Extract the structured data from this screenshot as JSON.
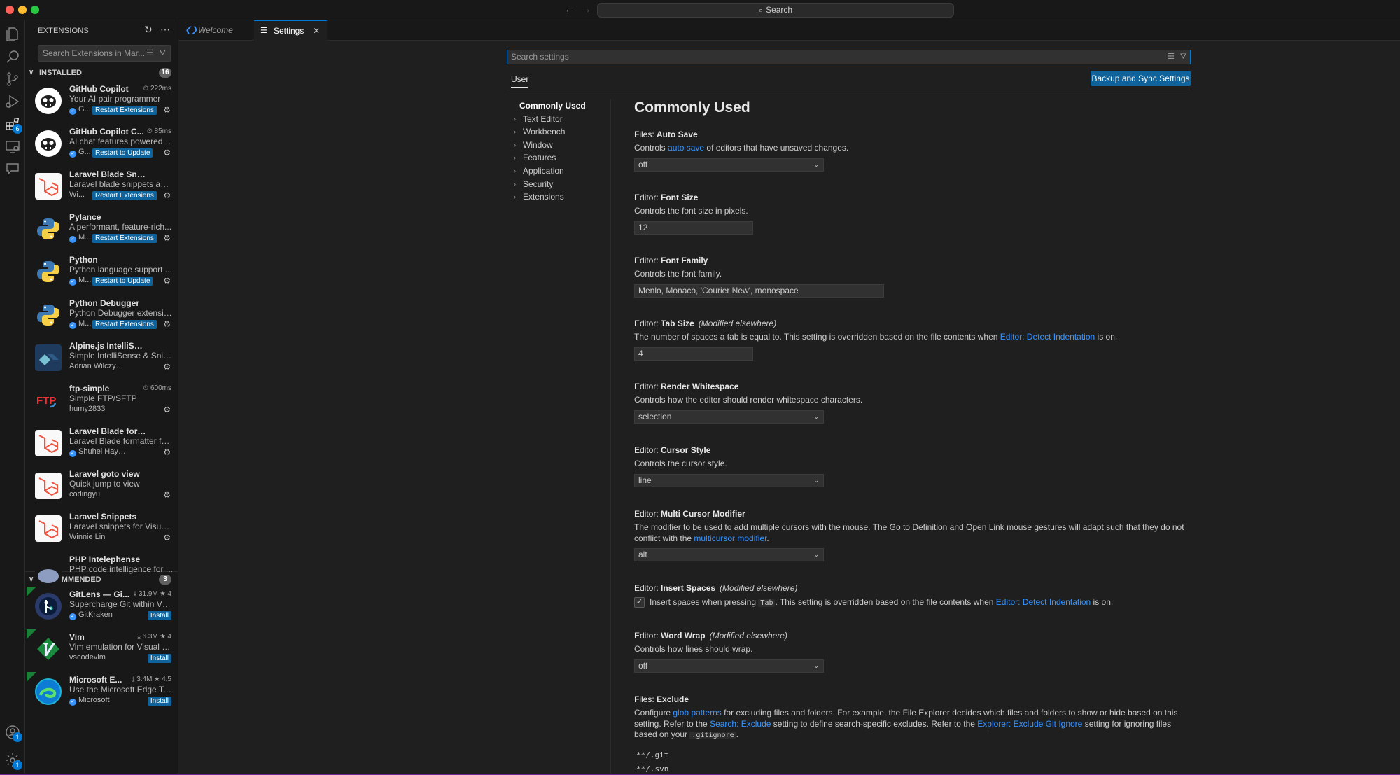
{
  "titlebar": {
    "search_label": "Search"
  },
  "sidebar": {
    "title": "EXTENSIONS",
    "search_placeholder": "Search Extensions in Mar...",
    "installed": {
      "label": "INSTALLED",
      "count": "16",
      "items": [
        {
          "name": "GitHub Copilot",
          "meta": "⏲ 222ms",
          "desc": "Your AI pair programmer",
          "pub": "G...",
          "action": "Restart Extensions",
          "icon": "copilot-icon"
        },
        {
          "name": "GitHub Copilot C...",
          "meta": "⏲ 85ms",
          "desc": "AI chat features powered b...",
          "pub": "G...",
          "action": "Restart to Update",
          "icon": "copilot-icon"
        },
        {
          "name": "Laravel Blade Snippets",
          "meta": "",
          "desc": "Laravel blade snippets and...",
          "pub": "Wi...",
          "action": "Restart Extensions",
          "icon": "laravel-icon"
        },
        {
          "name": "Pylance",
          "meta": "",
          "desc": "A performant, feature-rich...",
          "pub": "M...",
          "action": "Restart Extensions",
          "icon": "python-icon"
        },
        {
          "name": "Python",
          "meta": "",
          "desc": "Python language support ...",
          "pub": "M...",
          "action": "Restart to Update",
          "icon": "python-icon"
        },
        {
          "name": "Python Debugger",
          "meta": "",
          "desc": "Python Debugger extensio...",
          "pub": "M...",
          "action": "Restart Extensions",
          "icon": "python-icon"
        },
        {
          "name": "Alpine.js IntelliSense",
          "meta": "",
          "desc": "Simple IntelliSense & Snip...",
          "pub": "Adrian Wilczyński",
          "action": "",
          "icon": "alpine-icon"
        },
        {
          "name": "ftp-simple",
          "meta": "⏲ 600ms",
          "desc": "Simple FTP/SFTP",
          "pub": "humy2833",
          "action": "",
          "icon": "ftp-icon"
        },
        {
          "name": "Laravel Blade formatter",
          "meta": "",
          "desc": "Laravel Blade formatter for...",
          "pub": "Shuhei Hayashibara",
          "action": "",
          "icon": "laravel-icon"
        },
        {
          "name": "Laravel goto view",
          "meta": "",
          "desc": "Quick jump to view",
          "pub": "codingyu",
          "action": "",
          "icon": "laravel-icon"
        },
        {
          "name": "Laravel Snippets",
          "meta": "",
          "desc": "Laravel snippets for Visual ...",
          "pub": "Winnie Lin",
          "action": "",
          "icon": "laravel-icon"
        },
        {
          "name": "PHP Intelephense",
          "meta": "",
          "desc": "PHP code intelligence for ...",
          "pub": "",
          "action": "",
          "icon": "php-icon"
        }
      ]
    },
    "recommended": {
      "label": "RECOMMENDED",
      "count": "3",
      "items": [
        {
          "name": "GitLens — Gi...",
          "meta": "⤓ 31.9M ★ 4",
          "desc": "Supercharge Git within VS ...",
          "pub": "GitKraken",
          "action": "Install",
          "icon": "gitlens-icon"
        },
        {
          "name": "Vim",
          "meta": "⤓ 6.3M ★ 4",
          "desc": "Vim emulation for Visual S...",
          "pub": "vscodevim",
          "action": "Install",
          "icon": "vim-icon"
        },
        {
          "name": "Microsoft E...",
          "meta": "⤓ 3.4M ★ 4.5",
          "desc": "Use the Microsoft Edge To...",
          "pub": "Microsoft",
          "action": "Install",
          "icon": "edge-icon"
        }
      ]
    }
  },
  "tabs": {
    "welcome": "Welcome",
    "settings": "Settings"
  },
  "settings": {
    "search_placeholder": "Search settings",
    "scope_tab": "User",
    "backup_button": "Backup and Sync Settings",
    "toc": [
      "Commonly Used",
      "Text Editor",
      "Workbench",
      "Window",
      "Features",
      "Application",
      "Security",
      "Extensions"
    ],
    "section_title": "Commonly Used",
    "auto_save": {
      "cat": "Files: ",
      "key": "Auto Save",
      "desc_pre": "Controls ",
      "desc_link": "auto save",
      "desc_post": " of editors that have unsaved changes.",
      "value": "off"
    },
    "font_size": {
      "cat": "Editor: ",
      "key": "Font Size",
      "desc": "Controls the font size in pixels.",
      "value": "12"
    },
    "font_family": {
      "cat": "Editor: ",
      "key": "Font Family",
      "desc": "Controls the font family.",
      "value": "Menlo, Monaco, 'Courier New', monospace"
    },
    "tab_size": {
      "cat": "Editor: ",
      "key": "Tab Size",
      "mod": "(Modified elsewhere)",
      "desc_pre": "The number of spaces a tab is equal to. This setting is overridden based on the file contents when ",
      "desc_link": "Editor: Detect Indentation",
      "desc_post": " is on.",
      "value": "4"
    },
    "render_ws": {
      "cat": "Editor: ",
      "key": "Render Whitespace",
      "desc": "Controls how the editor should render whitespace characters.",
      "value": "selection"
    },
    "cursor_style": {
      "cat": "Editor: ",
      "key": "Cursor Style",
      "desc": "Controls the cursor style.",
      "value": "line"
    },
    "multi_cursor": {
      "cat": "Editor: ",
      "key": "Multi Cursor Modifier",
      "desc_pre": "The modifier to be used to add multiple cursors with the mouse. The Go to Definition and Open Link mouse gestures will adapt such that they do not conflict with the ",
      "desc_link": "multicursor modifier",
      "desc_post": ".",
      "value": "alt"
    },
    "insert_spaces": {
      "cat": "Editor: ",
      "key": "Insert Spaces",
      "mod": "(Modified elsewhere)",
      "text_pre": "Insert spaces when pressing ",
      "text_code": "Tab",
      "text_mid": ". This setting is overridden based on the file contents when ",
      "text_link": "Editor: Detect Indentation",
      "text_post": " is on.",
      "checked": "✓"
    },
    "word_wrap": {
      "cat": "Editor: ",
      "key": "Word Wrap",
      "mod": "(Modified elsewhere)",
      "desc": "Controls how lines should wrap.",
      "value": "off"
    },
    "files_exclude": {
      "cat": "Files: ",
      "key": "Exclude",
      "d1": "Configure ",
      "l1": "glob patterns",
      "d2": " for excluding files and folders. For example, the File Explorer decides which files and folders to show or hide based on this setting. Refer to the ",
      "l2": "Search: Exclude",
      "d3": " setting to define search-specific excludes. Refer to the ",
      "l3": "Explorer: Exclude Git Ignore",
      "d4": " setting for ignoring files based on your ",
      "code": ".gitignore",
      "d5": ".",
      "patterns": [
        "**/.git",
        "**/.svn"
      ]
    }
  },
  "colors": {
    "accent": "#0078d4",
    "button": "#0e639c",
    "link": "#3794ff"
  }
}
